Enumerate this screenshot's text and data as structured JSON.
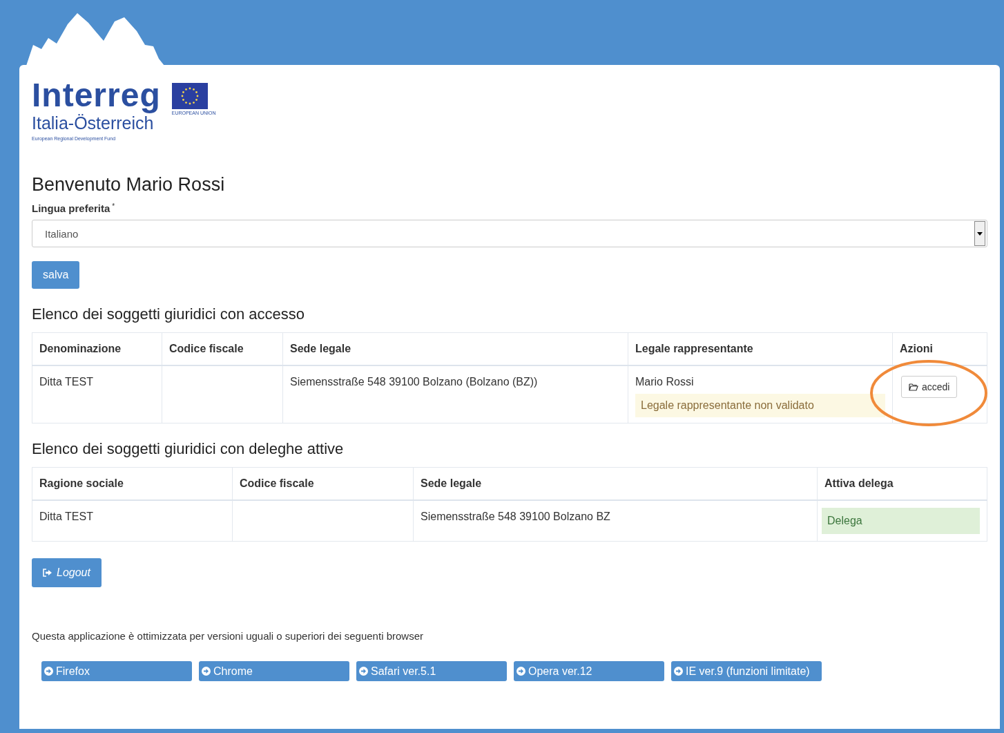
{
  "logo": {
    "wordmark": "Interreg",
    "region": "Italia-Österreich",
    "fund": "European Regional Development Fund",
    "eu_label": "EUROPEAN UNION"
  },
  "greeting": "Benvenuto Mario Rossi",
  "language": {
    "label": "Lingua preferita",
    "required_mark": "*",
    "value": "Italiano"
  },
  "save_button": "salva",
  "access_section": {
    "title": "Elenco dei soggetti giuridici con accesso",
    "columns": [
      "Denominazione",
      "Codice fiscale",
      "Sede legale",
      "Legale rappresentante",
      "Azioni"
    ],
    "rows": [
      {
        "name": "Ditta TEST",
        "tax_code": "",
        "address": "Siemensstraße 548 39100 Bolzano (Bolzano (BZ))",
        "representative": "Mario Rossi",
        "warning": "Legale rappresentante non validato",
        "action": "accedi",
        "highlighted": true
      }
    ]
  },
  "delegation_section": {
    "title": "Elenco dei soggetti giuridici con deleghe attive",
    "columns": [
      "Ragione sociale",
      "Codice fiscale",
      "Sede legale",
      "Attiva delega"
    ],
    "rows": [
      {
        "name": "Ditta TEST",
        "tax_code": "",
        "address": "Siemensstraße 548 39100 Bolzano BZ",
        "action": "Delega"
      }
    ]
  },
  "logout_button": "Logout",
  "browser_note": "Questa applicazione è ottimizzata per versioni uguali o superiori dei seguenti browser",
  "browsers": [
    "Firefox",
    "Chrome",
    "Safari ver.5.1",
    "Opera ver.12",
    "IE ver.9 (funzioni limitate)"
  ]
}
